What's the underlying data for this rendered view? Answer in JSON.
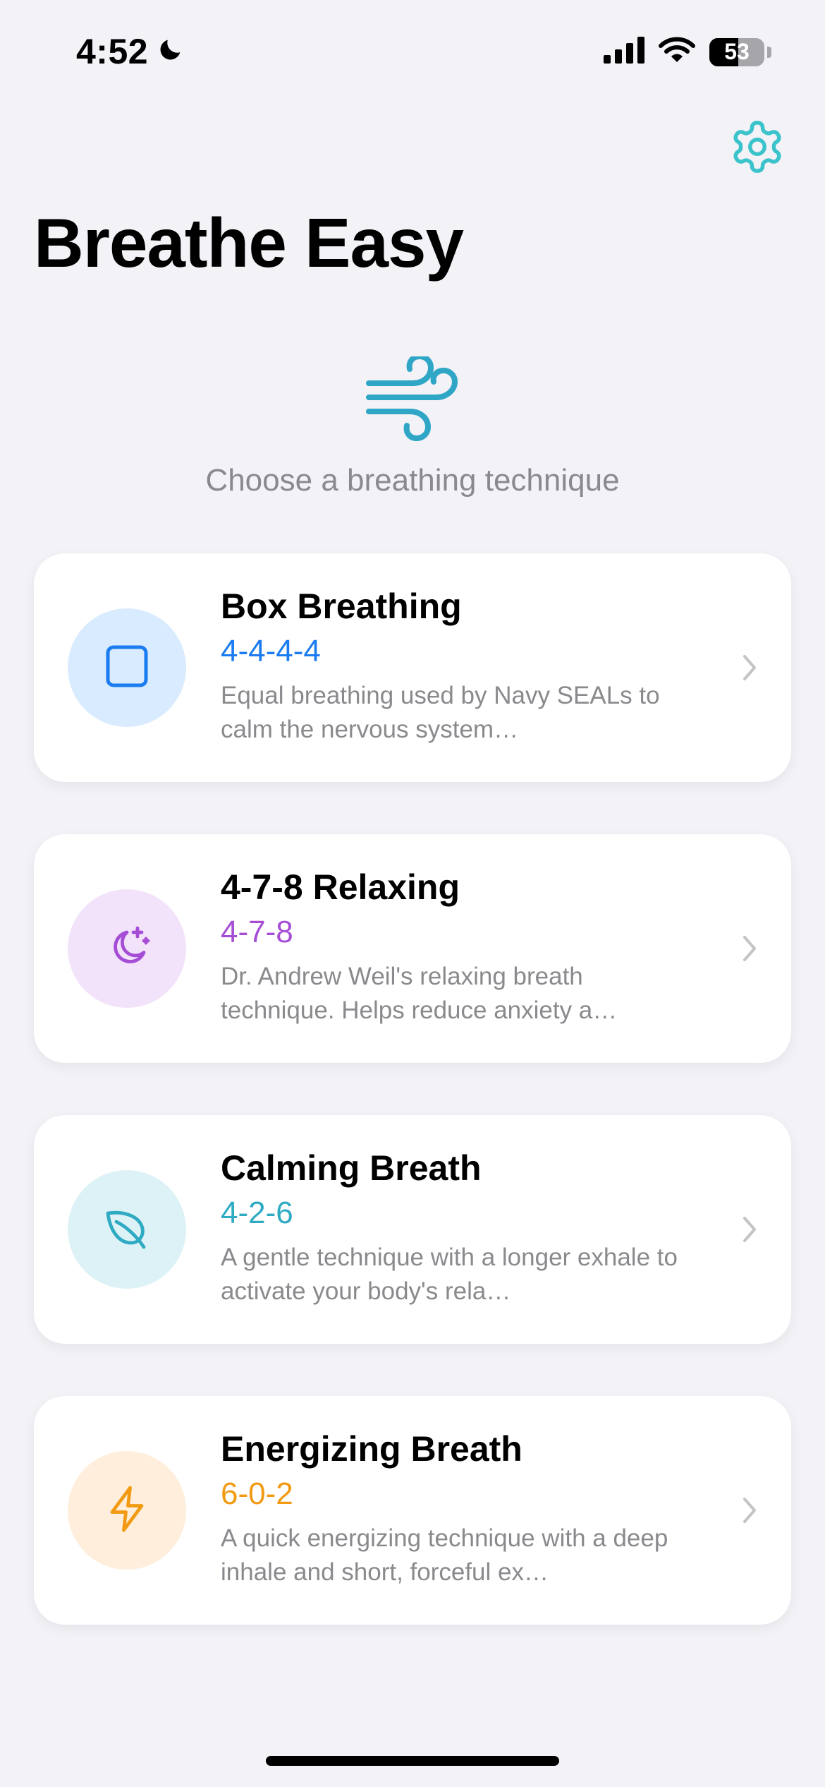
{
  "status_bar": {
    "time": "4:52",
    "battery_level": "53",
    "icons": [
      "moon-icon",
      "cellular-signal-icon",
      "wifi-icon",
      "battery-icon"
    ]
  },
  "header": {
    "title": "Breathe Easy",
    "settings_icon": "gear-icon",
    "accent_color": "#3BC3CB"
  },
  "hero": {
    "icon": "wind-icon",
    "subtitle": "Choose a breathing technique",
    "icon_color": "#2FA6C6"
  },
  "techniques": [
    {
      "title": "Box Breathing",
      "pattern": "4-4-4-4",
      "description": "Equal breathing used by Navy SEALs to calm the nervous system…",
      "icon": "square-icon",
      "color": "#1A7CF0",
      "bg": "#D9EBFE"
    },
    {
      "title": "4-7-8 Relaxing",
      "pattern": "4-7-8",
      "description": "Dr. Andrew Weil's relaxing breath technique. Helps reduce anxiety a…",
      "icon": "moon-stars-icon",
      "color": "#A64DD6",
      "bg": "#F2E3FA"
    },
    {
      "title": "Calming Breath",
      "pattern": "4-2-6",
      "description": "A gentle technique with a longer exhale to activate your body's rela…",
      "icon": "leaf-icon",
      "color": "#2EAAC2",
      "bg": "#DDF2F6"
    },
    {
      "title": "Energizing Breath",
      "pattern": "6-0-2",
      "description": "A quick energizing technique with a deep inhale and short, forceful ex…",
      "icon": "bolt-icon",
      "color": "#F19A12",
      "bg": "#FEEEDB"
    }
  ]
}
